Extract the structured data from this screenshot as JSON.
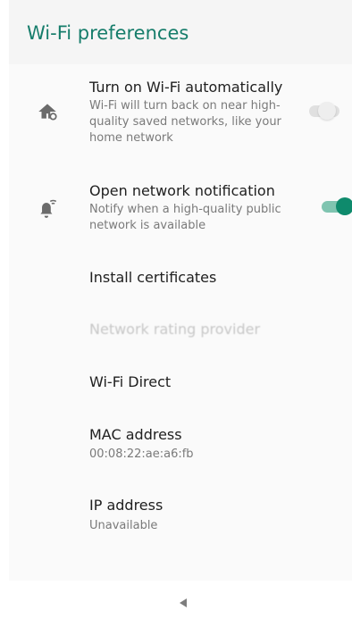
{
  "app": {
    "title": "Wi-Fi preferences",
    "accent_color": "#167d6b",
    "toggle_on_color": "#0e8a6c"
  },
  "preferences": [
    {
      "icon": "home-wifi-icon",
      "title": "Turn on Wi-Fi automatically",
      "summary": "Wi-Fi will turn back on near high-quality saved networks, like your home network",
      "toggle": false
    },
    {
      "icon": "wifi-notification-icon",
      "title": "Open network notification",
      "summary": "Notify when a high-quality public network is available",
      "toggle": true
    },
    {
      "title": "Install certificates"
    },
    {
      "title": "Network rating provider",
      "disabled": true
    },
    {
      "title": "Wi-Fi Direct"
    },
    {
      "title": "MAC address",
      "summary": "00:08:22:ae:a6:fb"
    },
    {
      "title": "IP address",
      "summary": "Unavailable"
    }
  ],
  "navbar": {
    "back_icon": "back-triangle-icon"
  }
}
